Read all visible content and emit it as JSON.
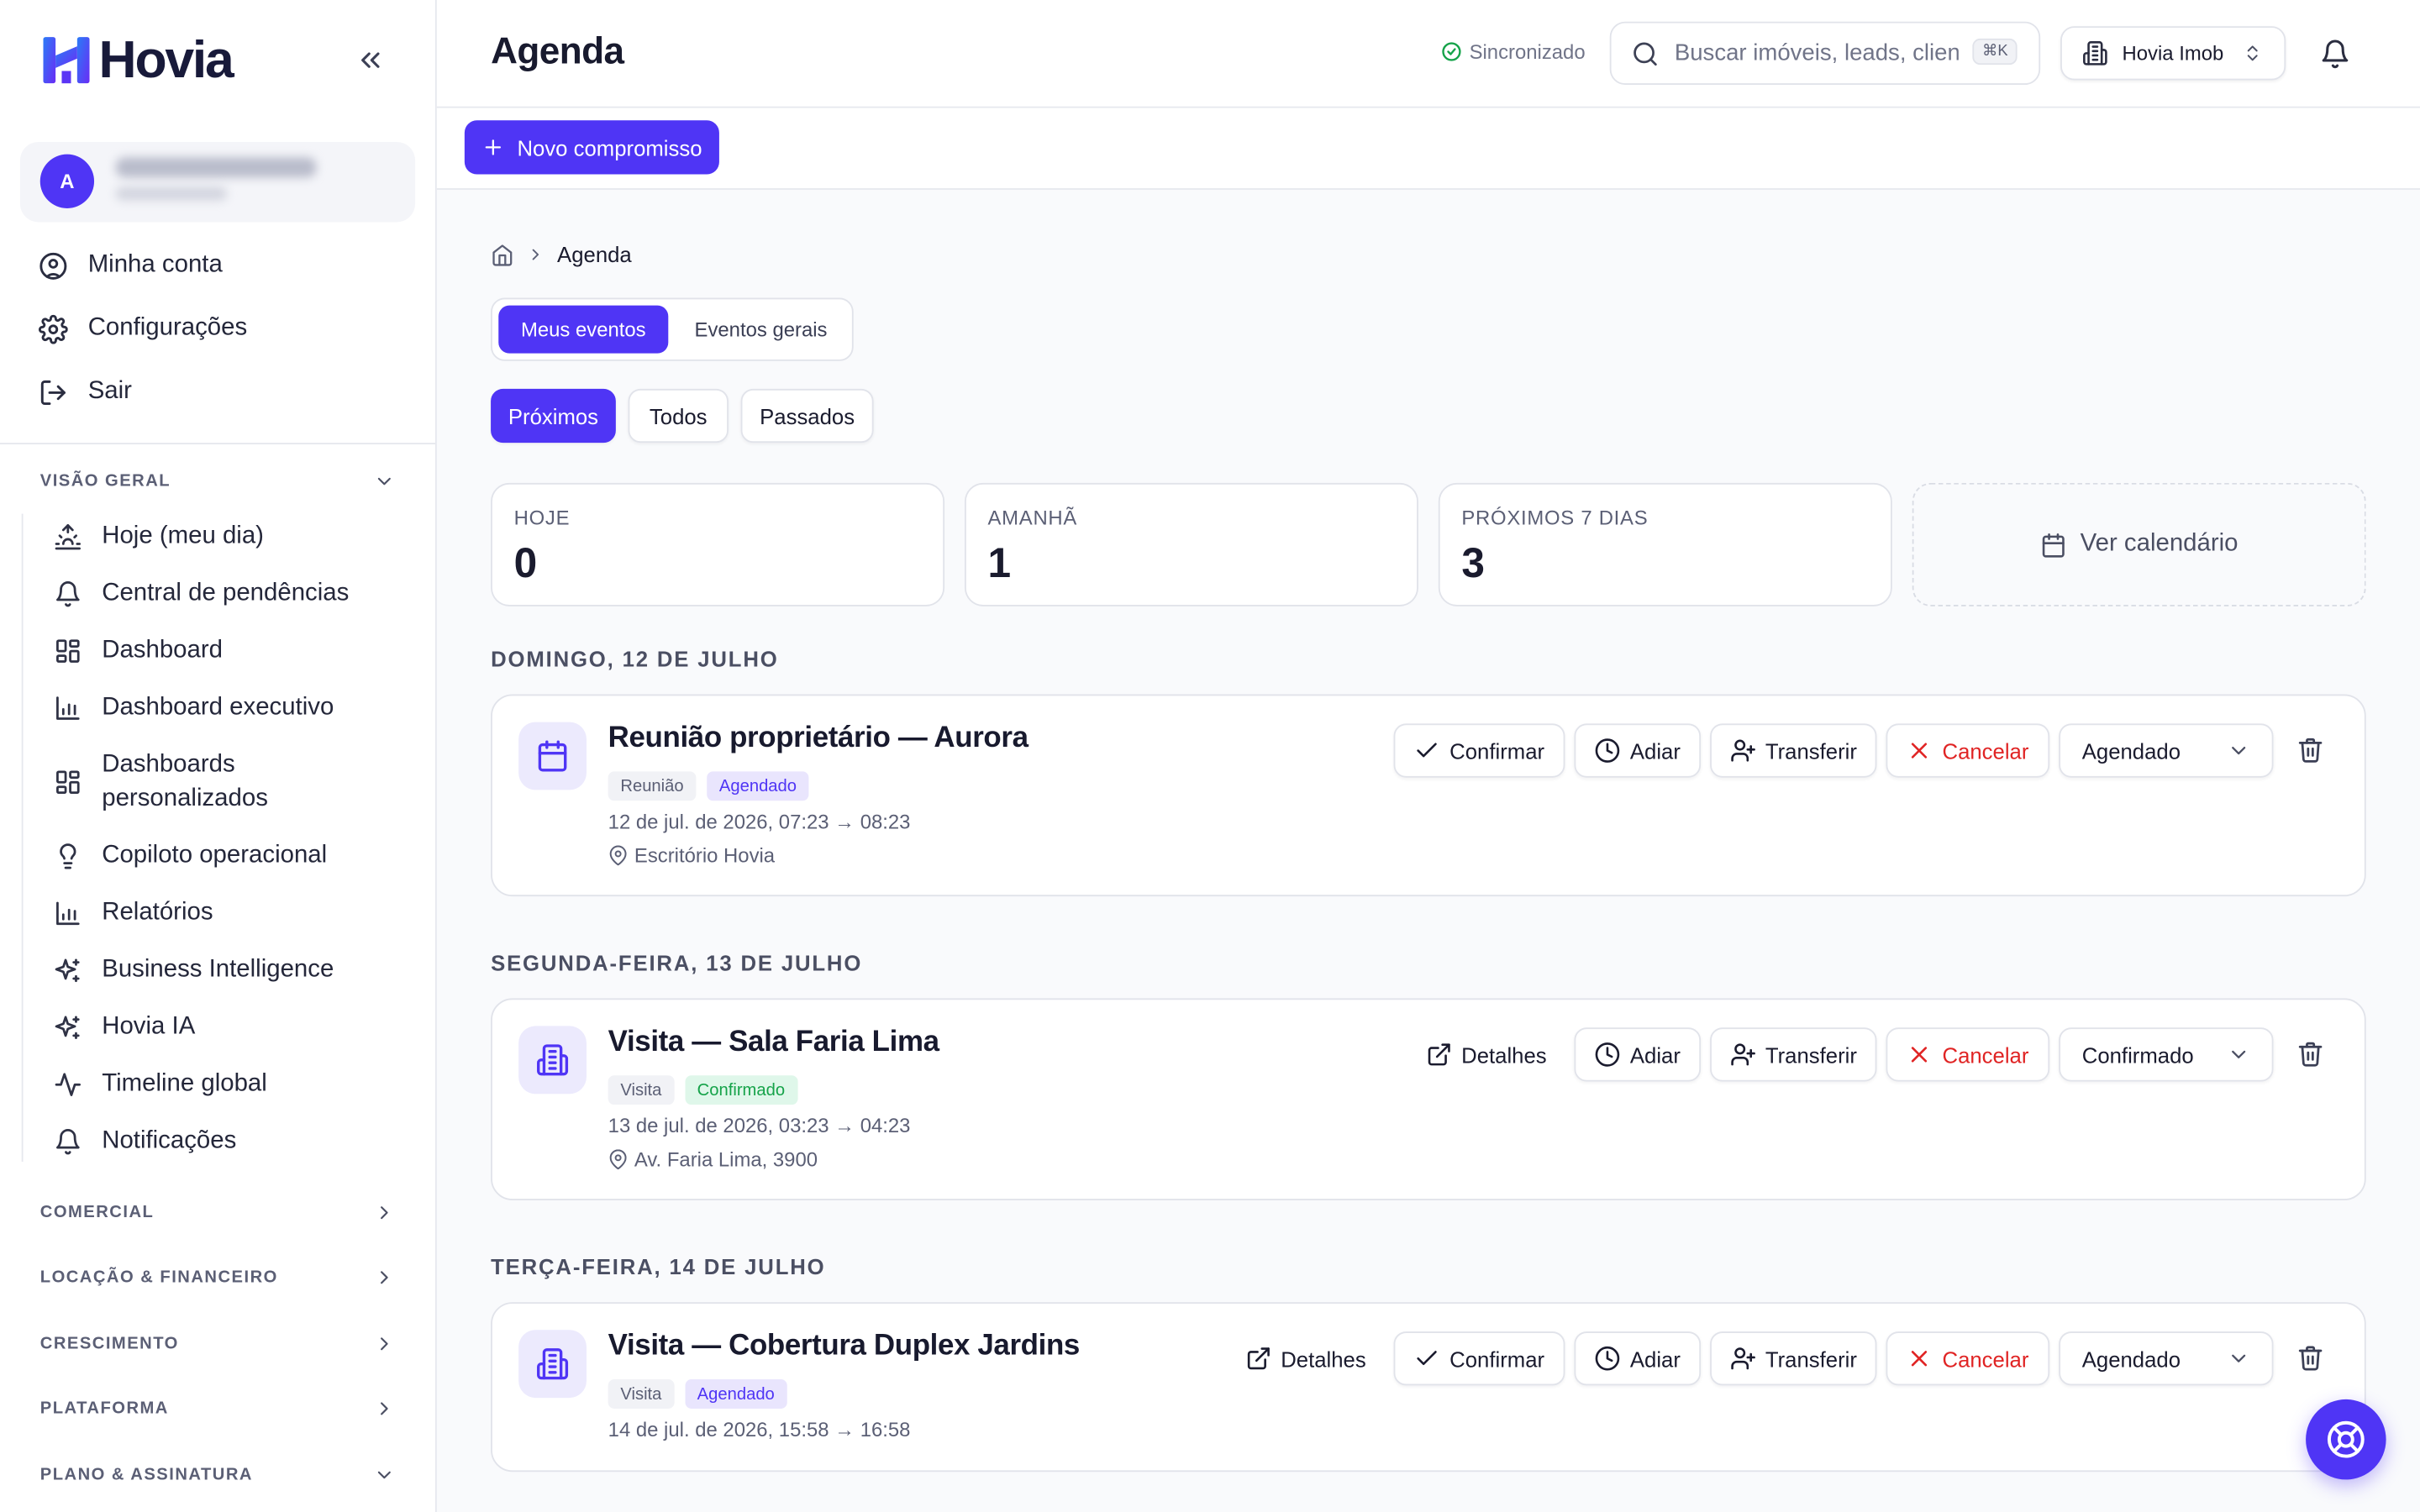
{
  "app": {
    "brand": "Hovia",
    "accent": "#4f35f5"
  },
  "user": {
    "initial": "A"
  },
  "account_menu": [
    {
      "label": "Minha conta",
      "icon": "user-circle-icon"
    },
    {
      "label": "Configurações",
      "icon": "gear-icon"
    },
    {
      "label": "Sair",
      "icon": "logout-icon"
    }
  ],
  "sidebar": {
    "overview_title": "VISÃO GERAL",
    "overview_items": [
      {
        "label": "Hoje (meu dia)",
        "icon": "sunrise-icon"
      },
      {
        "label": "Central de pendências",
        "icon": "bell-icon"
      },
      {
        "label": "Dashboard",
        "icon": "dashboard-grid-icon"
      },
      {
        "label": "Dashboard executivo",
        "icon": "bar-chart-icon"
      },
      {
        "label": "Dashboards personalizados",
        "icon": "dashboard-grid-icon"
      },
      {
        "label": "Copiloto operacional",
        "icon": "lightbulb-icon"
      },
      {
        "label": "Relatórios",
        "icon": "bar-chart-icon"
      },
      {
        "label": "Business Intelligence",
        "icon": "sparkles-icon"
      },
      {
        "label": "Hovia IA",
        "icon": "sparkles-icon"
      },
      {
        "label": "Timeline global",
        "icon": "activity-icon"
      },
      {
        "label": "Notificações",
        "icon": "bell-icon"
      }
    ],
    "sections": [
      {
        "label": "COMERCIAL"
      },
      {
        "label": "LOCAÇÃO & FINANCEIRO"
      },
      {
        "label": "CRESCIMENTO"
      },
      {
        "label": "PLATAFORMA"
      },
      {
        "label": "PLANO & ASSINATURA"
      }
    ]
  },
  "header": {
    "title": "Agenda",
    "sync_status": "Sincronizado",
    "search_placeholder": "Buscar imóveis, leads, clientes...",
    "search_shortcut": "⌘K",
    "tenant": "Hovia Imob"
  },
  "toolbar": {
    "new_label": "Novo compromisso"
  },
  "breadcrumb": {
    "current": "Agenda"
  },
  "scope_tabs": [
    {
      "label": "Meus eventos"
    },
    {
      "label": "Eventos gerais"
    }
  ],
  "filters": [
    {
      "label": "Próximos"
    },
    {
      "label": "Todos"
    },
    {
      "label": "Passados"
    }
  ],
  "stats": [
    {
      "label": "HOJE",
      "value": "0"
    },
    {
      "label": "AMANHÃ",
      "value": "1"
    },
    {
      "label": "PRÓXIMOS 7 DIAS",
      "value": "3"
    }
  ],
  "calendar_link": "Ver calendário",
  "actions": {
    "confirm": "Confirmar",
    "postpone": "Adiar",
    "transfer": "Transferir",
    "cancel": "Cancelar",
    "details": "Detalhes"
  },
  "days": [
    {
      "heading": "DOMINGO, 12 DE JULHO",
      "event": {
        "title": "Reunião proprietário — Aurora",
        "type": "Reunião",
        "status": "Agendado",
        "time": "12 de jul. de 2026, 07:23 → 08:23",
        "location": "Escritório Hovia"
      }
    },
    {
      "heading": "SEGUNDA-FEIRA, 13 DE JULHO",
      "event": {
        "title": "Visita — Sala Faria Lima",
        "type": "Visita",
        "status": "Confirmado",
        "time": "13 de jul. de 2026, 03:23 → 04:23",
        "location": "Av. Faria Lima, 3900"
      }
    },
    {
      "heading": "TERÇA-FEIRA, 14 DE JULHO",
      "event": {
        "title": "Visita — Cobertura Duplex Jardins",
        "type": "Visita",
        "status": "Agendado",
        "time": "14 de jul. de 2026, 15:58 → 16:58"
      }
    }
  ]
}
